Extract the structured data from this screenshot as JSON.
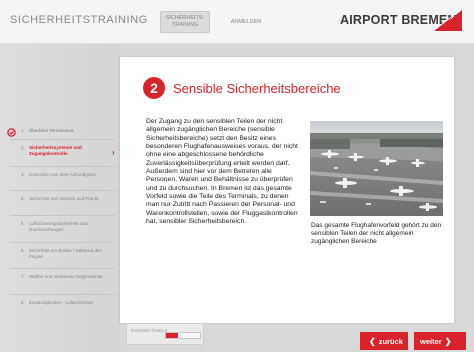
{
  "header": {
    "app_title": "SICHERHEITSTRAINING",
    "tabs": [
      "SICHERHEITS-TRAINING",
      "ANMELDEN"
    ],
    "brand": "AIRPORT BREMEN"
  },
  "colors": {
    "accent": "#d8232a",
    "panel": "#ffffff",
    "chrome": "#d9d9d9"
  },
  "page": {
    "number": "2",
    "title": "Sensible Sicherheitsbereiche",
    "body": "Der Zugang zu den sensiblen Teilen der nicht allgemein zugänglichen Bereiche (sensible Sicherheitsbereiche) setzt den Besitz eines besonderen Flughafenausweises voraus, der nicht ohne eine abgeschlossene behördliche Zuverlässigkeitsüberprüfung erteilt werden darf. Außerdem sind hier vor dem Betreten alle Personen, Waren und Behältnisse zu überprüfen und zu durchsuchen. In Bremen ist das gesamte Vorfeld sowie die Teile des Terminals, zu denen man nur Zutritt nach Passieren der Personal- und Warenkontrollstellen, sowie der Fluggastkontrollen hat, sensibler Sicherheitsbereich.",
    "caption": "Das gesamte Flughafenvorfeld gehört zu den sensiblen Teilen der nicht allgemein zugänglichen Bereiche",
    "photo_icon": "airport-apron-photo"
  },
  "nav": {
    "items": [
      {
        "num": "1.",
        "label": "Überblick Terrorismus",
        "state": "done"
      },
      {
        "num": "2.",
        "label": "Sicherheitssysteme und Zugangskontrolle",
        "state": "active"
      },
      {
        "num": "3.",
        "label": "Kontrollen von dem Ankunftgelan",
        "state": "todo"
      },
      {
        "num": "4.",
        "label": "Sicherheit von Gepäck und Fracht",
        "state": "todo"
      },
      {
        "num": "5.",
        "label": "Luftsicherungssicherheit und Durchsuchungen",
        "state": "todo"
      },
      {
        "num": "6.",
        "label": "Sicherheit am Boden / während des Fluges",
        "state": "todo"
      },
      {
        "num": "7.",
        "label": "Waffen und verbotene Gegenstände",
        "state": "todo"
      },
      {
        "num": "8.",
        "label": "Zuständigkeiten - Luftsicherheit",
        "state": "todo"
      }
    ]
  },
  "progress": {
    "label": "Fortschritt Thema 2",
    "value": 0.35
  },
  "footer": {
    "back": "zurück",
    "next": "weiter"
  }
}
